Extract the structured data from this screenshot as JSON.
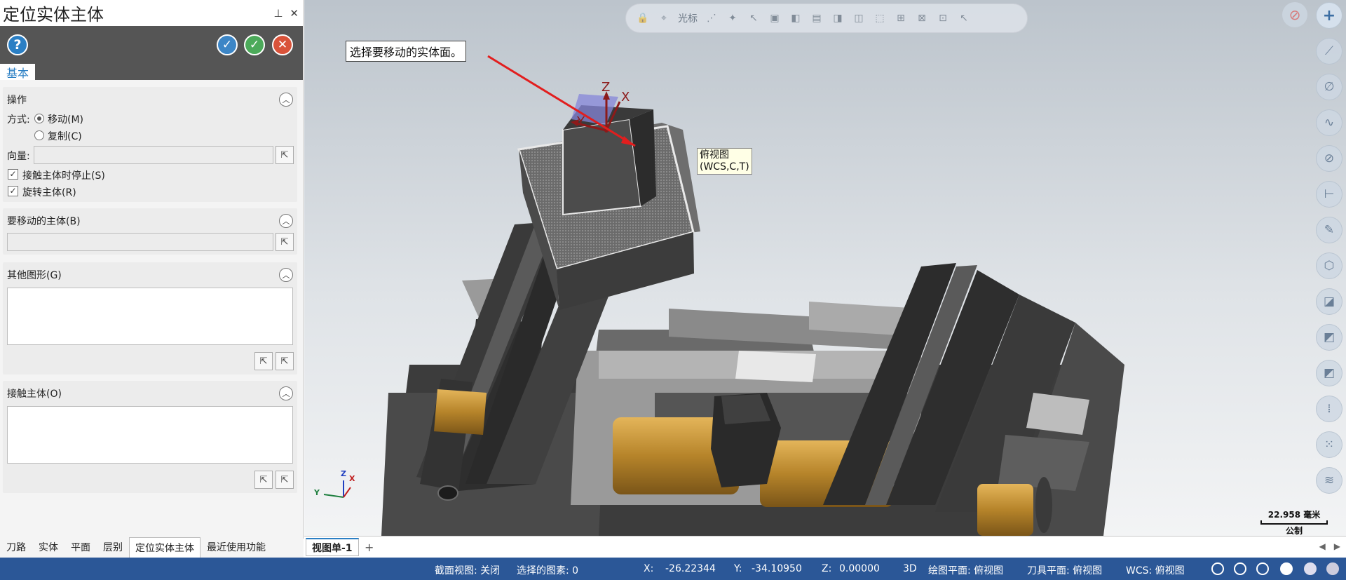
{
  "panel": {
    "title": "定位实体主体",
    "pin_icon": "pin-icon",
    "close_icon": "close-icon",
    "help_label": "?",
    "tab_basic": "基本",
    "group_operation": {
      "title": "操作",
      "method_label": "方式:",
      "option_move": "移动(M)",
      "option_copy": "复制(C)",
      "vector_label": "向量:",
      "stop_on_contact": "接触主体时停止(S)",
      "rotate_body": "旋转主体(R)"
    },
    "group_body_to_move": {
      "title": "要移动的主体(B)"
    },
    "group_other_geometry": {
      "title": "其他图形(G)"
    },
    "group_contact_body": {
      "title": "接触主体(O)"
    }
  },
  "bottom_tabs": [
    "刀路",
    "实体",
    "平面",
    "层别",
    "定位实体主体",
    "最近使用功能"
  ],
  "toolbar": {
    "cursor_label": "光标"
  },
  "viewport": {
    "instruction": "选择要移动的实体面。",
    "tooltip_line1": "俯视图",
    "tooltip_line2": "(WCS,C,T)",
    "axis_z": "Z",
    "axis_x": "X",
    "axis_y": "Y",
    "scale_value": "22.958 毫米",
    "scale_unit": "公制"
  },
  "view_tabs": {
    "active": "视图单-1",
    "add": "+"
  },
  "status": {
    "section_view": "截面视图: 关闭",
    "selected": "选择的图素: 0",
    "x_label": "X:",
    "x_value": "-26.22344",
    "y_label": "Y:",
    "y_value": "-34.10950",
    "z_label": "Z:",
    "z_value": "0.00000",
    "mode": "3D",
    "drawing_plane": "绘图平面: 俯视图",
    "tool_plane": "刀具平面: 俯视图",
    "wcs": "WCS: 俯视图"
  },
  "colors": {
    "status_bar": "#2b5797",
    "panel_header": "#555555",
    "accent": "#2b7fc4",
    "brass": "#c8962e"
  }
}
